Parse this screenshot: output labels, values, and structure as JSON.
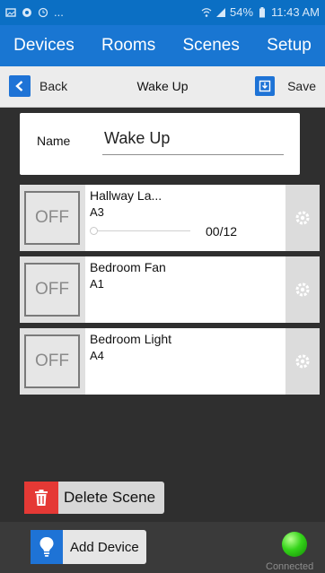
{
  "status": {
    "dots": "...",
    "battery": "54%",
    "time": "11:43 AM"
  },
  "nav": {
    "tabs": [
      {
        "label": "Devices"
      },
      {
        "label": "Rooms"
      },
      {
        "label": "Scenes"
      },
      {
        "label": "Setup"
      }
    ]
  },
  "toolbar": {
    "back_label": "Back",
    "title": "Wake Up",
    "save_label": "Save"
  },
  "scene": {
    "name_label": "Name",
    "name_value": "Wake Up"
  },
  "devices": [
    {
      "name": "Hallway La...",
      "address": "A3",
      "state_label": "OFF",
      "level": "00/12",
      "level_fraction": 0.0
    },
    {
      "name": "Bedroom Fan",
      "address": "A1",
      "state_label": "OFF"
    },
    {
      "name": "Bedroom Light",
      "address": "A4",
      "state_label": "OFF"
    }
  ],
  "actions": {
    "delete_label": "Delete Scene",
    "add_label": "Add Device"
  },
  "connection": {
    "label": "Connected",
    "color": "#34d419"
  },
  "colors": {
    "accent": "#1976d2",
    "danger": "#e53935"
  }
}
